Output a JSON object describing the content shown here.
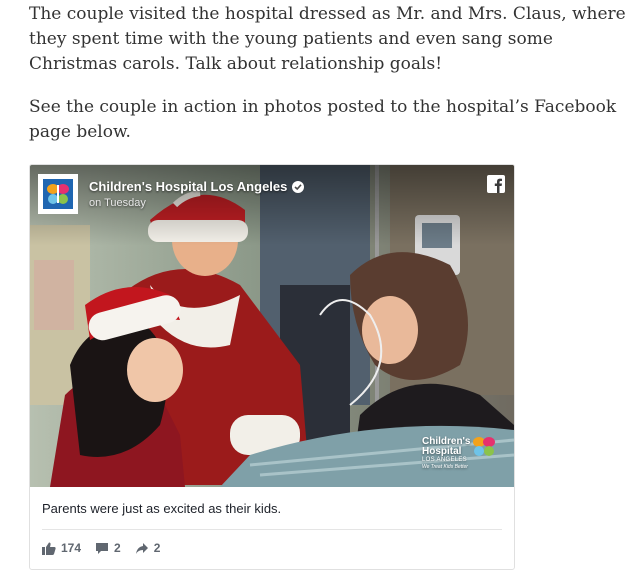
{
  "article": {
    "paragraph1": "The couple visited the hospital dressed as Mr. and Mrs. Claus, where they spent time with the young patients and even sang some Christmas carols. Talk about relationship goals!",
    "paragraph2": "See the couple in action in photos posted to the hospital’s Facebook page below."
  },
  "post": {
    "page_name": "Children's Hospital Los Angeles",
    "time": "on Tuesday",
    "caption": "Parents were just as excited as their kids.",
    "watermark": {
      "line1": "Children's",
      "line2": "Hospital",
      "line3": "LOS ANGELES",
      "tagline": "We Treat Kids Better"
    },
    "stats": {
      "likes": "174",
      "comments": "2",
      "shares": "2"
    },
    "icons": {
      "platform": "facebook-icon",
      "verified": "verified-badge-icon",
      "like": "thumbs-up-icon",
      "comment": "comment-icon",
      "share": "share-arrow-icon"
    },
    "colors": {
      "facebook_gray": "#606770",
      "text": "#1d2129"
    }
  }
}
